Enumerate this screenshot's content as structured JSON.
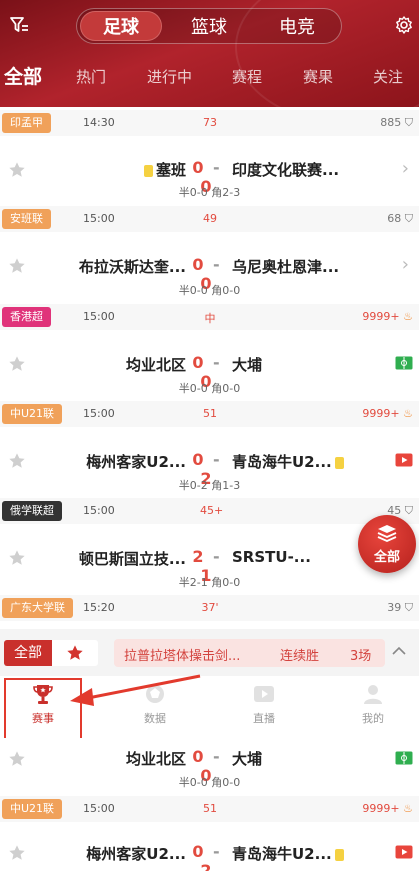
{
  "header": {
    "sport_tabs": [
      {
        "label": "足球",
        "active": true
      },
      {
        "label": "篮球",
        "active": false
      },
      {
        "label": "电竞",
        "active": false
      }
    ],
    "nav_tabs": [
      {
        "label": "全部",
        "active": true
      },
      {
        "label": "热门",
        "active": false
      },
      {
        "label": "进行中",
        "active": false
      },
      {
        "label": "赛程",
        "active": false
      },
      {
        "label": "赛果",
        "active": false
      },
      {
        "label": "关注",
        "active": false
      }
    ]
  },
  "list": {
    "leagues": [
      {
        "tag": "印孟甲",
        "tag_color": "#f0a15a",
        "time": "14:30",
        "status": "73",
        "count": "885",
        "hot": false
      },
      {
        "tag": "安班联",
        "tag_color": "#f0a15a",
        "time": "15:00",
        "status": "49",
        "count": "68",
        "hot": false
      },
      {
        "tag": "香港超",
        "tag_color": "#e0337a",
        "time": "15:00",
        "status": "中",
        "count": "9999+",
        "hot": true
      },
      {
        "tag": "中U21联",
        "tag_color": "#f0a15a",
        "time": "15:00",
        "status": "51",
        "count": "9999+",
        "hot": true
      },
      {
        "tag": "俄学联超",
        "tag_color": "#333333",
        "time": "15:00",
        "status": "45+",
        "count": "45",
        "hot": false
      },
      {
        "tag": "广东大学联",
        "tag_color": "#f0a15a",
        "time": "15:20",
        "status": "37'",
        "count": "39",
        "hot": false
      }
    ],
    "matches": [
      {
        "home": "塞班",
        "score_home": "0",
        "score_away": "0",
        "away": "印度文化联赛...",
        "sub": "半0-0 角2-3",
        "home_card": true,
        "away_card": false,
        "right": "chevron"
      },
      {
        "home": "布拉沃斯达奎...",
        "score_home": "0",
        "score_away": "0",
        "away": "乌尼奥杜恩津...",
        "sub": "半0-0 角0-0",
        "home_card": false,
        "away_card": false,
        "right": "chevron"
      },
      {
        "home": "均业北区",
        "score_home": "0",
        "score_away": "0",
        "away": "大埔",
        "sub": "半0-0 角0-0",
        "home_card": false,
        "away_card": false,
        "right": "live-green"
      },
      {
        "home": "梅州客家U2...",
        "score_home": "0",
        "score_away": "2",
        "away": "青岛海牛U2...",
        "sub": "半0-2 角1-3",
        "home_card": false,
        "away_card": true,
        "right": "live-red"
      },
      {
        "home": "顿巴斯国立技...",
        "score_home": "2",
        "score_away": "1",
        "away": "SRSTU-...",
        "sub": "半2-1 角0-0",
        "home_card": false,
        "away_card": false,
        "right": "none"
      }
    ],
    "float_button": "全部"
  },
  "filter_strip": {
    "all_label": "全部",
    "promo_team": "拉普拉塔体操击剑...",
    "promo_streak": "连续胜",
    "promo_count": "3场"
  },
  "bottom_nav": [
    {
      "label": "赛事",
      "icon": "trophy-icon",
      "active": true
    },
    {
      "label": "数据",
      "icon": "data-icon",
      "active": false
    },
    {
      "label": "直播",
      "icon": "play-icon",
      "active": false
    },
    {
      "label": "我的",
      "icon": "profile-icon",
      "active": false
    }
  ],
  "lower_list": {
    "match1": {
      "home": "均业北区",
      "score_home": "0",
      "score_away": "0",
      "away": "大埔",
      "sub": "半0-0 角0-0"
    },
    "league": {
      "tag": "中U21联",
      "time": "15:00",
      "status": "51",
      "count": "9999+"
    },
    "match2": {
      "home": "梅州客家U2...",
      "score_home": "0",
      "score_away": "2",
      "away": "青岛海牛U2..."
    }
  },
  "colors": {
    "accent": "#c9302c",
    "score": "#e24b3f",
    "header": "#a11d25"
  }
}
